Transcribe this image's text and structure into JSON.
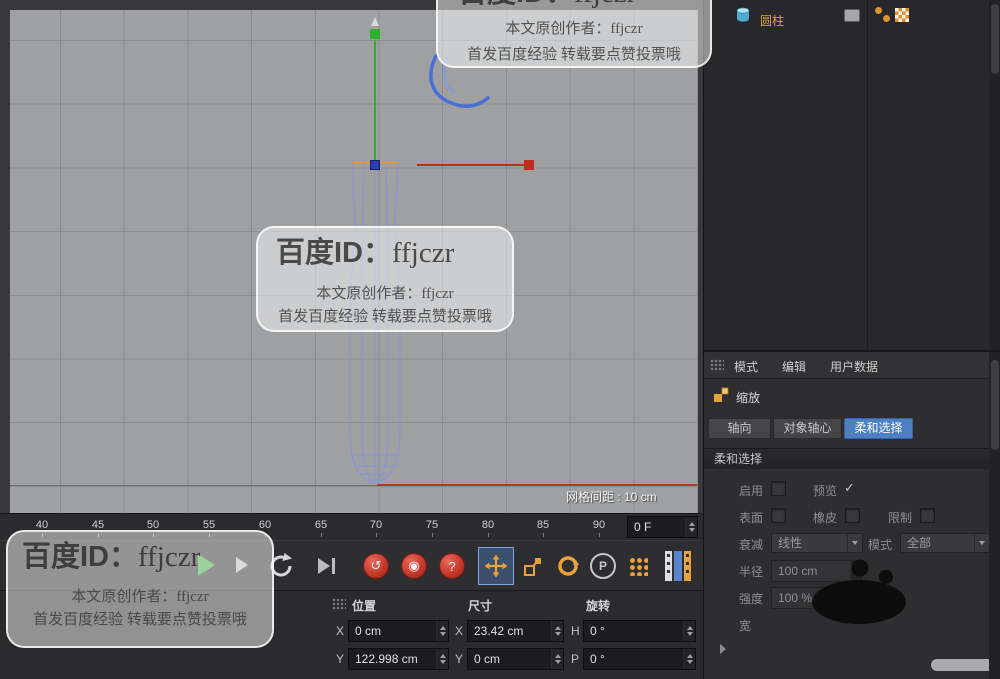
{
  "colors": {
    "orange": "#e8a23c",
    "blue": "#4d7fc4",
    "red": "#c03427",
    "green": "#3cae3c",
    "wireframe": "#8694da"
  },
  "viewport": {
    "grid_spacing_label": "网格间距 : 10 cm"
  },
  "watermark": {
    "badge_prefix": "百度ID：",
    "badge_id": "ffjczr",
    "author_line": "本文原创作者：ffjczr",
    "footer_line": "首发百度经验 转载要点赞投票哦"
  },
  "object_manager": {
    "items": [
      {
        "label": "圆柱",
        "icon": "cylinder-icon"
      }
    ]
  },
  "attributes": {
    "menu": [
      "模式",
      "编辑",
      "用户数据"
    ],
    "tool_label": "缩放",
    "tabs": [
      {
        "label": "轴向"
      },
      {
        "label": "对象轴心"
      },
      {
        "label": "柔和选择"
      }
    ],
    "section_title": "柔和选择",
    "fields": {
      "enable_label": "启用",
      "preview_label": "预览",
      "preview_check": "✓",
      "surface_label": "表面",
      "rubber_label": "橡皮",
      "limit_label": "限制",
      "falloff_label": "衰减",
      "falloff_value": "线性",
      "mode_label": "模式",
      "mode_value": "全部",
      "radius_label": "半径",
      "radius_value": "100 cm",
      "strength_label": "强度",
      "strength_value": "100 %",
      "width_label": "宽"
    }
  },
  "timeline": {
    "ticks": [
      "40",
      "45",
      "50",
      "55",
      "60",
      "65",
      "70",
      "75",
      "80",
      "85",
      "90"
    ],
    "frame_value": "0 F"
  },
  "toolbar": {
    "p_label": "P",
    "record_icons": [
      "↺",
      "◉",
      "?"
    ]
  },
  "coords": {
    "position_header": "位置",
    "size_header": "尺寸",
    "rotation_header": "旋转",
    "pos_x_label": "X",
    "pos_x": "0 cm",
    "pos_y_label": "Y",
    "pos_y": "122.998 cm",
    "size_x_label": "X",
    "size_x": "23.42 cm",
    "size_y_label": "Y",
    "size_y": "0 cm",
    "rot_h_label": "H",
    "rot_h": "0 °",
    "rot_p_label": "P",
    "rot_p": "0 °"
  }
}
